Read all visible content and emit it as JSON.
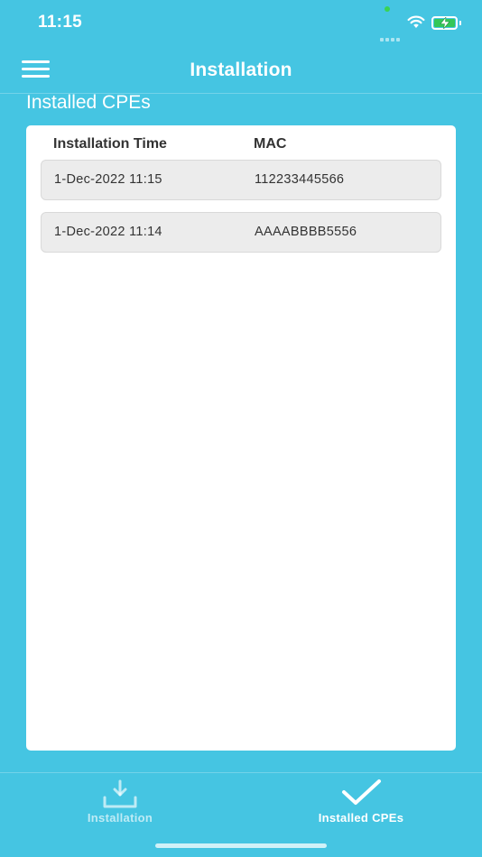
{
  "status_bar": {
    "time": "11:15",
    "icons": [
      "signal-icon",
      "wifi-icon",
      "battery-charging-icon"
    ],
    "battery_color": "#34c759"
  },
  "nav": {
    "title": "Installation",
    "menu_icon": "hamburger-menu-icon"
  },
  "section_title": "Installed CPEs",
  "table": {
    "columns": [
      "Installation Time",
      "MAC"
    ],
    "rows": [
      {
        "time": "1-Dec-2022 11:15",
        "mac": "112233445566"
      },
      {
        "time": "1-Dec-2022 11:14",
        "mac": "AAAABBBB5556"
      }
    ]
  },
  "tab_bar": {
    "tabs": [
      {
        "label": "Installation",
        "icon": "download-tray-icon",
        "active": false
      },
      {
        "label": "Installed CPEs",
        "icon": "checkmark-icon",
        "active": true
      }
    ]
  },
  "colors": {
    "background": "#45c5e2",
    "card": "#ffffff",
    "row": "#ececec"
  }
}
